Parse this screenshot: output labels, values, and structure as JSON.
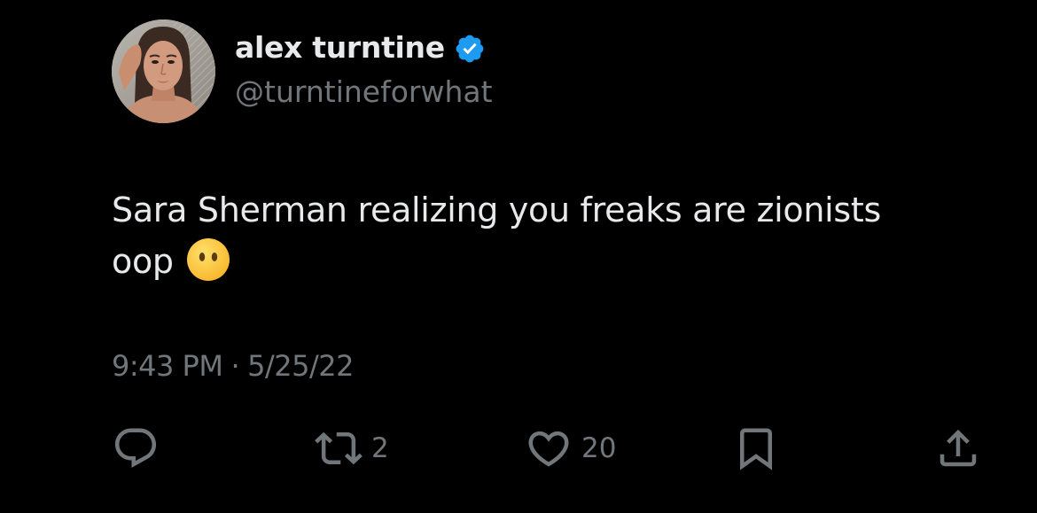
{
  "author": {
    "display_name": "alex turntine",
    "handle": "@turntineforwhat",
    "verified": true,
    "verified_color": "#1d9bf0"
  },
  "tweet": {
    "text_line1": "Sara Sherman realizing you freaks are zionists",
    "text_line2": "oop",
    "emoji": "face-without-mouth-icon"
  },
  "meta": {
    "time": "9:43 PM",
    "separator": "·",
    "date": "5/25/22"
  },
  "actions": {
    "reply": {
      "icon": "reply-icon"
    },
    "retweet": {
      "icon": "retweet-icon",
      "count": "2"
    },
    "like": {
      "icon": "heart-icon",
      "count": "20"
    },
    "bookmark": {
      "icon": "bookmark-icon"
    },
    "share": {
      "icon": "share-icon"
    }
  },
  "colors": {
    "background": "#000000",
    "primary_text": "#e7e9ea",
    "secondary_text": "#71767b"
  }
}
